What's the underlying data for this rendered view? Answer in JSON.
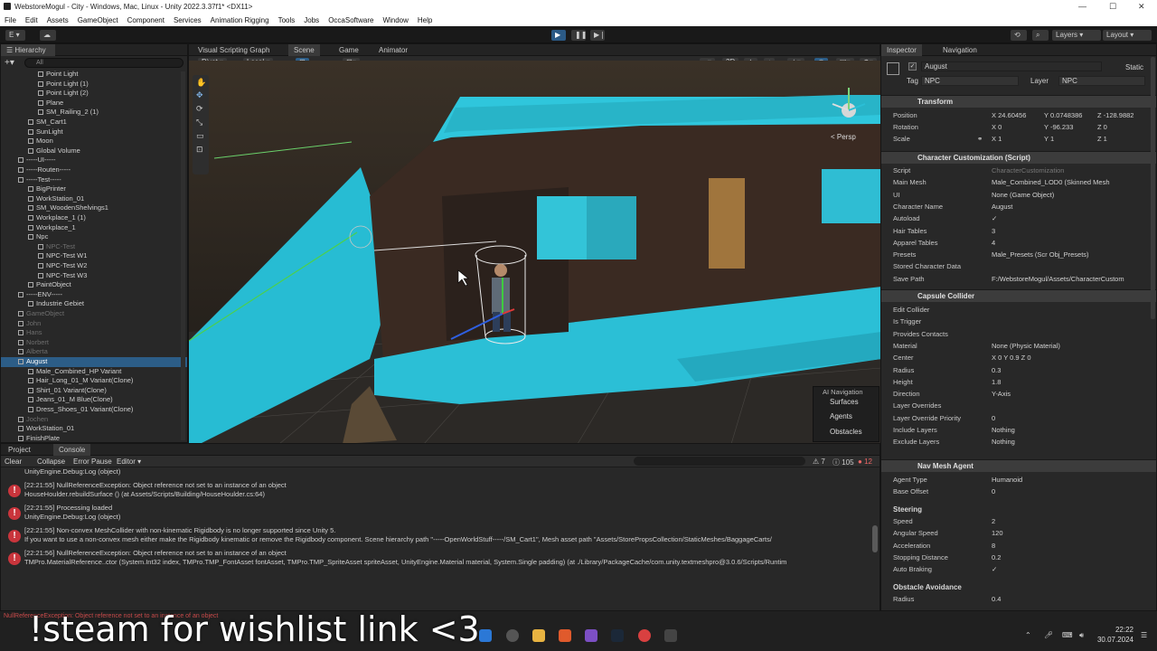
{
  "window": {
    "title": "WebstoreMogul - City - Windows, Mac, Linux - Unity 2022.3.37f1* <DX11>"
  },
  "menu": [
    "File",
    "Edit",
    "Assets",
    "GameObject",
    "Component",
    "Services",
    "Animation Rigging",
    "Tools",
    "Jobs",
    "OccaSoftware",
    "Window",
    "Help"
  ],
  "toolbar": {
    "account": "E",
    "layers": "Layers",
    "layout": "Layout"
  },
  "hierarchy": {
    "tab": "Hierarchy",
    "search_placeholder": "All",
    "items": [
      {
        "label": "Point Light",
        "indent": 3
      },
      {
        "label": "Point Light (1)",
        "indent": 3
      },
      {
        "label": "Point Light (2)",
        "indent": 3
      },
      {
        "label": "Plane",
        "indent": 3
      },
      {
        "label": "SM_Railing_2 (1)",
        "indent": 3
      },
      {
        "label": "SM_Cart1",
        "indent": 2
      },
      {
        "label": "SunLight",
        "indent": 2
      },
      {
        "label": "Moon",
        "indent": 2
      },
      {
        "label": "Global Volume",
        "indent": 2
      },
      {
        "label": "-----UI-----",
        "indent": 1
      },
      {
        "label": "-----Routen-----",
        "indent": 1
      },
      {
        "label": "-----Test-----",
        "indent": 1
      },
      {
        "label": "BigPrinter",
        "indent": 2
      },
      {
        "label": "WorkStation_01",
        "indent": 2
      },
      {
        "label": "SM_WoodenShelvings1",
        "indent": 2
      },
      {
        "label": "Workplace_1 (1)",
        "indent": 2
      },
      {
        "label": "Workplace_1",
        "indent": 2
      },
      {
        "label": "Npc",
        "indent": 2
      },
      {
        "label": "NPC-Test",
        "indent": 3,
        "dim": true
      },
      {
        "label": "NPC-Test W1",
        "indent": 3
      },
      {
        "label": "NPC-Test W2",
        "indent": 3
      },
      {
        "label": "NPC-Test W3",
        "indent": 3
      },
      {
        "label": "PaintObject",
        "indent": 2
      },
      {
        "label": "-----ENV-----",
        "indent": 1
      },
      {
        "label": "Industrie Gebiet",
        "indent": 2
      },
      {
        "label": "GameObject",
        "indent": 1,
        "dim": true
      },
      {
        "label": "John",
        "indent": 1,
        "dim": true
      },
      {
        "label": "Hans",
        "indent": 1,
        "dim": true
      },
      {
        "label": "Norbert",
        "indent": 1,
        "dim": true
      },
      {
        "label": "Alberta",
        "indent": 1,
        "dim": true
      },
      {
        "label": "August",
        "indent": 1,
        "sel": true
      },
      {
        "label": "Male_Combined_HP Variant",
        "indent": 2
      },
      {
        "label": "Hair_Long_01_M Variant(Clone)",
        "indent": 2
      },
      {
        "label": "Shirt_01 Variant(Clone)",
        "indent": 2
      },
      {
        "label": "Jeans_01_M Blue(Clone)",
        "indent": 2
      },
      {
        "label": "Dress_Shoes_01 Variant(Clone)",
        "indent": 2
      },
      {
        "label": "Jochen",
        "indent": 1,
        "dim": true
      },
      {
        "label": "WorkStation_01",
        "indent": 1
      },
      {
        "label": "FinishPlate",
        "indent": 1
      }
    ]
  },
  "scene": {
    "tabs": [
      "Visual Scripting Graph",
      "Scene",
      "Game",
      "Animator"
    ],
    "active_tab": "Scene",
    "pivot": "Pivot",
    "local": "Local",
    "mode_2d": "2D",
    "persp": "< Persp",
    "ai_nav": {
      "title": "AI Navigation",
      "items": [
        "Surfaces",
        "Agents",
        "Obstacles"
      ]
    }
  },
  "console": {
    "tabs": [
      "Project",
      "Console"
    ],
    "active_tab": "Console",
    "buttons": [
      "Clear",
      "Collapse",
      "Error Pause",
      "Editor"
    ],
    "counts": {
      "warnings": "7",
      "messages": "105",
      "errors": "12"
    },
    "lines": [
      {
        "text": "UnityEngine.Debug:Log (object)",
        "err": false
      },
      {
        "text": "[22:21:55] NullReferenceException: Object reference not set to an instance of an object",
        "err": true
      },
      {
        "text": "HouseHoulder.rebuildSurface () (at Assets/Scripts/Building/HouseHoulder.cs:64)",
        "err": false
      },
      {
        "text": "[22:21:55] Processing loaded",
        "err": true
      },
      {
        "text": "UnityEngine.Debug:Log (object)",
        "err": false
      },
      {
        "text": "[22:21:55] Non-convex MeshCollider with non-kinematic Rigidbody is no longer supported since Unity 5.",
        "err": true
      },
      {
        "text": "If you want to use a non-convex mesh either make the Rigidbody kinematic or remove the Rigidbody component. Scene hierarchy path \"-----OpenWorldStuff-----/SM_Cart1\", Mesh asset path \"Assets/StorePropsCollection/StaticMeshes/BaggageCarts/",
        "err": false
      },
      {
        "text": "[22:21:56] NullReferenceException: Object reference not set to an instance of an object",
        "err": true
      },
      {
        "text": "TMPro.MaterialReference..ctor (System.Int32 index, TMPro.TMP_FontAsset fontAsset, TMPro.TMP_SpriteAsset spriteAsset, UnityEngine.Material material, System.Single padding) (at ./Library/PackageCache/com.unity.textmeshpro@3.0.6/Scripts/Runtim",
        "err": false
      }
    ],
    "status": "NullReferenceException: Object reference not set to an instance of an object"
  },
  "inspector": {
    "tabs": [
      "Inspector",
      "Navigation"
    ],
    "object_name": "August",
    "static_label": "Static",
    "tag_label": "Tag",
    "tag_value": "NPC",
    "layer_label": "Layer",
    "layer_value": "NPC",
    "transform": {
      "title": "Transform",
      "position": {
        "label": "Position",
        "x": "24.60456",
        "y": "0.0748386",
        "z": "-128.9882"
      },
      "rotation": {
        "label": "Rotation",
        "x": "0",
        "y": "-96.233",
        "z": "0"
      },
      "scale": {
        "label": "Scale",
        "x": "1",
        "y": "1",
        "z": "1"
      }
    },
    "charcust": {
      "title": "Character Customization (Script)",
      "rows": [
        {
          "label": "Script",
          "value": "CharacterCustomization",
          "dim": true
        },
        {
          "label": "Main Mesh",
          "value": "Male_Combined_LOD0 (Skinned Mesh"
        },
        {
          "label": "UI",
          "value": "None (Game Object)"
        },
        {
          "label": "Character Name",
          "value": "August"
        },
        {
          "label": "Autoload",
          "value": "✓"
        },
        {
          "label": "Hair Tables",
          "value": "3"
        },
        {
          "label": "Apparel Tables",
          "value": "4"
        },
        {
          "label": "Presets",
          "value": "Male_Presets (Scr Obj_Presets)"
        },
        {
          "label": "Stored Character Data",
          "value": ""
        },
        {
          "label": "Save Path",
          "value": "F:/WebstoreMogul/Assets/CharacterCustom"
        }
      ]
    },
    "capsule": {
      "title": "Capsule Collider",
      "rows": [
        {
          "label": "Edit Collider",
          "value": ""
        },
        {
          "label": "Is Trigger",
          "value": ""
        },
        {
          "label": "Provides Contacts",
          "value": ""
        },
        {
          "label": "Material",
          "value": "None (Physic Material)"
        },
        {
          "label": "Center",
          "value": "X 0          Y 0.9          Z 0"
        },
        {
          "label": "Radius",
          "value": "0.3"
        },
        {
          "label": "Height",
          "value": "1.8"
        },
        {
          "label": "Direction",
          "value": "Y-Axis"
        },
        {
          "label": "Layer Overrides",
          "value": ""
        },
        {
          "label": "Layer Override Priority",
          "value": "0"
        },
        {
          "label": "Include Layers",
          "value": "Nothing"
        },
        {
          "label": "Exclude Layers",
          "value": "Nothing"
        }
      ]
    },
    "navmesh": {
      "title": "Nav Mesh Agent",
      "rows": [
        {
          "label": "Agent Type",
          "value": "Humanoid"
        },
        {
          "label": "Base Offset",
          "value": "0"
        }
      ],
      "steering_title": "Steering",
      "steering": [
        {
          "label": "Speed",
          "value": "2"
        },
        {
          "label": "Angular Speed",
          "value": "120"
        },
        {
          "label": "Acceleration",
          "value": "8"
        },
        {
          "label": "Stopping Distance",
          "value": "0.2"
        },
        {
          "label": "Auto Braking",
          "value": "✓"
        }
      ],
      "avoid_title": "Obstacle Avoidance",
      "avoid": [
        {
          "label": "Radius",
          "value": "0.4"
        }
      ]
    }
  },
  "overlay_text": "!steam for wishlist link <3",
  "taskbar": {
    "time": "22:22",
    "date": "30.07.2024"
  }
}
